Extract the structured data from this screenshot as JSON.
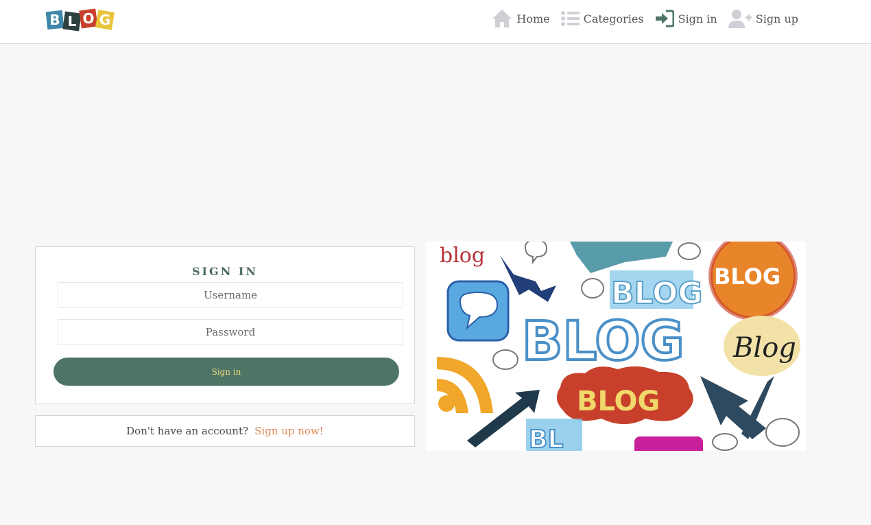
{
  "brand": {
    "logo_letters": [
      "B",
      "L",
      "O",
      "G"
    ],
    "logo_colors": [
      "#3f87a8",
      "#2e3f3f",
      "#c9402a",
      "#e8c53a"
    ]
  },
  "nav": {
    "items": [
      {
        "label": "Home",
        "icon": "home-icon"
      },
      {
        "label": "Categories",
        "icon": "list-icon"
      },
      {
        "label": "Sign in",
        "icon": "sign-in-icon"
      },
      {
        "label": "Sign up",
        "icon": "user-plus-icon"
      }
    ]
  },
  "signin": {
    "title": "SIGN IN",
    "username_placeholder": "Username",
    "password_placeholder": "Password",
    "button_label": "Sign in"
  },
  "signup_prompt": {
    "text": "Don't have an account?",
    "link_label": "Sign up now!"
  },
  "illustration": {
    "words": [
      "blog",
      "BLOG",
      "BLOG",
      "BLOG",
      "Blog",
      "BLOG",
      "BL"
    ]
  },
  "colors": {
    "accent_green": "#4e7466",
    "button_text": "#f2dc7a",
    "link_orange": "#e08a5a",
    "page_bg": "#f7f7f7"
  }
}
